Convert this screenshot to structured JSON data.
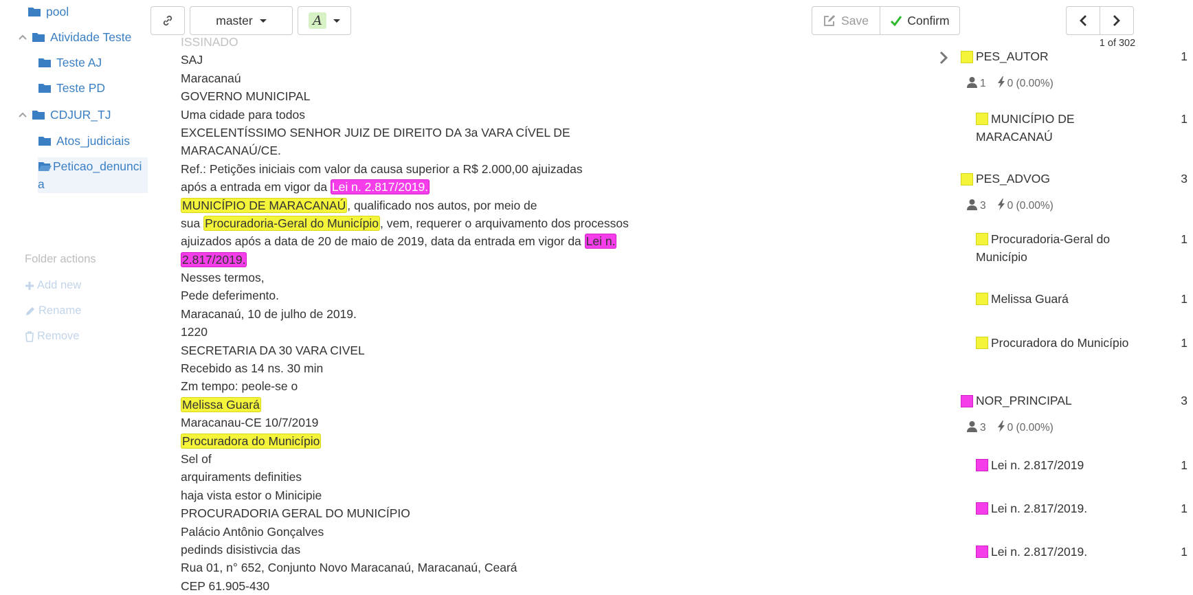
{
  "sidebar": {
    "folders": [
      {
        "label": "pool",
        "caret": ""
      },
      {
        "label": "Atividade Teste",
        "caret": "^"
      },
      {
        "label": "Teste AJ",
        "caret": ""
      },
      {
        "label": "Teste PD",
        "caret": ""
      },
      {
        "label": "CDJUR_TJ",
        "caret": "^"
      },
      {
        "label": "Atos_judiciais",
        "caret": ""
      },
      {
        "label": "Peticao_denuncia",
        "caret": ""
      }
    ],
    "folder_actions": {
      "title": "Folder actions",
      "add_new": "Add new",
      "rename": "Rename",
      "remove": "Remove"
    }
  },
  "toolbar": {
    "link_icon": "link-icon",
    "branch": "master",
    "font_letter": "A",
    "save_label": "Save",
    "confirm_label": "Confirm",
    "pager": "1 of 302",
    "colors": {
      "confirm_check": "#2eb82e",
      "font_chip": "#d6f1c4"
    }
  },
  "document": {
    "lines": [
      "ISSINADO",
      "SAJ",
      "Maracanaú",
      "GOVERNO MUNICIPAL",
      "Uma cidade para todos",
      "EXCELENTÍSSIMO SENHOR JUIZ DE DIREITO DA 3a VARA CÍVEL DE",
      "MARACANAÚ/CE.",
      "Ref.: Petições iniciais com valor da causa superior a R$ 2.000,00 ajuizadas",
      {
        "pre": "após a entrada em vigor da ",
        "hl": "Lei n. 2.817/2019.",
        "post": ""
      },
      {
        "pre": "",
        "hl": "MUNICÍPIO DE MARACANAÚ",
        "post": ", qualificado nos autos, por meio de"
      },
      {
        "pre": "sua ",
        "hl": "Procuradoria-Geral do Município",
        "post": ", vem, requerer o arquivamento dos processos"
      },
      {
        "pre": "ajuizados após a data de 20 de maio de 2019, data da entrada em vigor da ",
        "hl": "Lei n.",
        "post": ""
      },
      {
        "pre": "",
        "hl": "2.817/2019.",
        "post": ""
      },
      "Nesses termos,",
      "Pede deferimento.",
      "Maracanaú, 10 de julho de 2019.",
      "1220",
      "SECRETARIA DA 30 VARA CIVEL",
      "Recebido as 14 ns. 30 min",
      "Zm tempo: peole-se o",
      {
        "pre": "",
        "hl": "Melissa Guará",
        "post": ""
      },
      "Maracanau-CE 10/7/2019",
      {
        "pre": "",
        "hl": "Procuradora do Município",
        "post": ""
      },
      "Sel of",
      "arquiraments definities",
      "haja vista estor o Minicipie",
      "PROCURADORIA GERAL DO MUNICÍPIO",
      "Palácio Antônio Gonçalves",
      "pedinds disistivcia das",
      "Rua 01, n° 652, Conjunto Novo Maracanaú, Maracanaú, Ceará",
      "CEP 61.905-430"
    ],
    "highlight_colors": {
      "entity_yellow": "#f4f43a",
      "entity_magenta": "#f53ee9"
    }
  },
  "entities": [
    {
      "name": "PES_AUTOR",
      "count": "1",
      "color": "yellow",
      "annotators": "1",
      "score": "0 (0.00%)",
      "instances": [
        {
          "text": "MUNICÍPIO DE MARACANAÚ",
          "count": "1"
        }
      ]
    },
    {
      "name": "PES_ADVOG",
      "count": "3",
      "color": "yellow",
      "annotators": "3",
      "score": "0 (0.00%)",
      "instances": [
        {
          "text": "Procuradoria-Geral do Município",
          "count": "1"
        },
        {
          "text": "Melissa Guará",
          "count": "1"
        },
        {
          "text": "Procuradora do Município",
          "count": "1"
        }
      ]
    },
    {
      "name": "NOR_PRINCIPAL",
      "count": "3",
      "color": "magenta",
      "annotators": "3",
      "score": "0 (0.00%)",
      "instances": [
        {
          "text": "Lei n. 2.817/2019",
          "count": "1"
        },
        {
          "text": "Lei n. 2.817/2019.",
          "count": "1"
        },
        {
          "text": "Lei n. 2.817/2019.",
          "count": "1"
        }
      ]
    }
  ]
}
